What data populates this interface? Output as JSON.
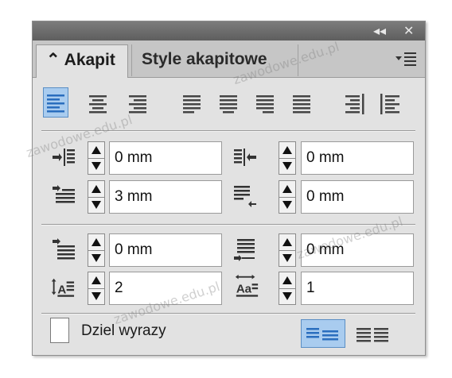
{
  "panel": {
    "titlebar": {
      "collapse_glyph": "◂◂",
      "close_glyph": "✕"
    },
    "tabs": [
      {
        "label": "⌃ Akapit",
        "active": true
      },
      {
        "label": "Style akapitowe",
        "active": false
      }
    ],
    "menu_icon": "panel-menu-icon"
  },
  "alignment": {
    "buttons": [
      {
        "name": "align-left",
        "selected": true
      },
      {
        "name": "align-center",
        "selected": false
      },
      {
        "name": "align-right",
        "selected": false
      },
      {
        "name": "justify-left",
        "selected": false
      },
      {
        "name": "justify-center",
        "selected": false
      },
      {
        "name": "justify-right",
        "selected": false
      },
      {
        "name": "justify-all",
        "selected": false
      },
      {
        "name": "align-toward-spine",
        "selected": false
      },
      {
        "name": "align-away-from-spine",
        "selected": false
      }
    ]
  },
  "indents": {
    "left_indent": "0 mm",
    "right_indent": "0 mm",
    "first_line_indent": "3 mm",
    "last_line_right_indent": "0 mm"
  },
  "spacing": {
    "space_before": "0 mm",
    "space_after": "0 mm",
    "drop_cap_lines": "2",
    "drop_cap_chars": "1"
  },
  "hyphenate": {
    "label": "Dziel wyrazy",
    "checked": false
  },
  "watermark": "zawodowe.edu.pl",
  "colors": {
    "selected_bg": "#a9ccef",
    "selected_border": "#5a8ec4",
    "icon_blue": "#2a6ebe"
  }
}
